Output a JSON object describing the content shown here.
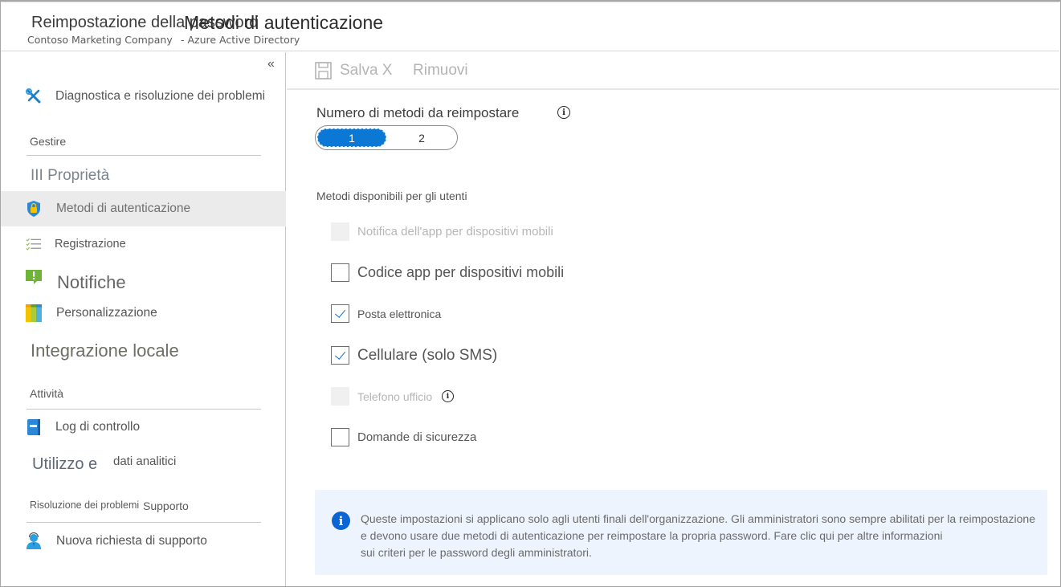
{
  "header": {
    "title_part1": "Reimpostazione della password",
    "title_part2": "Metodi di autenticazione",
    "subtitle_part1": "Contoso Marketing Company",
    "subtitle_part2": "- Azure Active Directory"
  },
  "sidebar": {
    "collapse_glyph": "«",
    "diagnose": "Diagnostica e risoluzione dei problemi",
    "sections": {
      "manage": "Gestire",
      "activity": "Attività",
      "support": "Risoluzione dei problemi + Supporto"
    },
    "items": {
      "properties": "III Proprietà",
      "auth_methods": "Metodi di autenticazione",
      "registration": "Registrazione",
      "notifications": "Notifiche",
      "customization": "Personalizzazione",
      "onprem": "Integrazione locale",
      "audit_logs": "Log di controllo",
      "usage_part1": "Utilizzo e",
      "usage_part2": "dati analitici",
      "new_support": "Nuova richiesta di supporto"
    },
    "support_part1": "Risoluzione dei problemi",
    "support_part2": "Supporto",
    "active_item": "auth_methods"
  },
  "toolbar": {
    "save_label": "Salva X",
    "remove_label": "Rimuovi"
  },
  "form": {
    "num_methods_label": "Numero di metodi da reimpostare",
    "num_methods_options": [
      "1",
      "2"
    ],
    "num_methods_selected": "1",
    "methods_heading": "Metodi disponibili per gli utenti",
    "methods": [
      {
        "label": "Notifica dell'app per dispositivi mobili",
        "checked": false,
        "disabled": true
      },
      {
        "label": "Codice app per dispositivi mobili",
        "checked": false,
        "disabled": false
      },
      {
        "label": "Posta elettronica",
        "checked": true,
        "disabled": false
      },
      {
        "label": "Cellulare (solo SMS)",
        "checked": true,
        "disabled": false
      },
      {
        "label": "Telefono ufficio",
        "checked": false,
        "disabled": true,
        "has_info": true
      },
      {
        "label": "Domande di sicurezza",
        "checked": false,
        "disabled": false
      }
    ]
  },
  "infobox": {
    "icon": "info-icon",
    "line1": "Queste impostazioni si applicano solo agli utenti finali dell'organizzazione. Gli amministratori sono sempre abilitati per la reimpostazione",
    "line2": "e devono usare due metodi di autenticazione per reimpostare la propria password. Fare clic qui per altre informazioni",
    "line3": "sui criteri per le password degli amministratori."
  },
  "colors": {
    "accent": "#0b78d6",
    "info_bg": "#eef4fe",
    "active_nav_bg": "#ebebeb"
  }
}
